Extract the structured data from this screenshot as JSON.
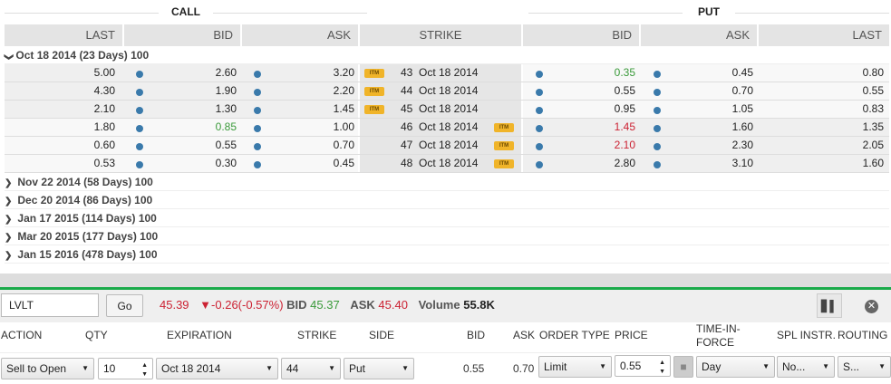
{
  "sections": {
    "call": "CALL",
    "put": "PUT"
  },
  "headers": [
    "LAST",
    "BID",
    "ASK",
    "STRIKE",
    "BID",
    "ASK",
    "LAST"
  ],
  "expanded_group": "Oct 18 2014 (23 Days) 100",
  "rows": [
    {
      "c_last": "5.00",
      "c_bid": "2.60",
      "c_ask": "3.20",
      "strike": "43",
      "exp": "Oct 18 2014",
      "itm": "call",
      "p_bid": "0.35",
      "p_ask": "0.45",
      "p_last": "0.80",
      "c_bid_color": "",
      "p_bid_color": "g"
    },
    {
      "c_last": "4.30",
      "c_bid": "1.90",
      "c_ask": "2.20",
      "strike": "44",
      "exp": "Oct 18 2014",
      "itm": "call",
      "p_bid": "0.55",
      "p_ask": "0.70",
      "p_last": "0.55",
      "c_bid_color": "",
      "p_bid_color": ""
    },
    {
      "c_last": "2.10",
      "c_bid": "1.30",
      "c_ask": "1.45",
      "strike": "45",
      "exp": "Oct 18 2014",
      "itm": "call",
      "p_bid": "0.95",
      "p_ask": "1.05",
      "p_last": "0.83",
      "c_bid_color": "",
      "p_bid_color": ""
    },
    {
      "c_last": "1.80",
      "c_bid": "0.85",
      "c_ask": "1.00",
      "strike": "46",
      "exp": "Oct 18 2014",
      "itm": "put",
      "p_bid": "1.45",
      "p_ask": "1.60",
      "p_last": "1.35",
      "c_bid_color": "g",
      "p_bid_color": "rd"
    },
    {
      "c_last": "0.60",
      "c_bid": "0.55",
      "c_ask": "0.70",
      "strike": "47",
      "exp": "Oct 18 2014",
      "itm": "put",
      "p_bid": "2.10",
      "p_ask": "2.30",
      "p_last": "2.05",
      "c_bid_color": "",
      "p_bid_color": "rd"
    },
    {
      "c_last": "0.53",
      "c_bid": "0.30",
      "c_ask": "0.45",
      "strike": "48",
      "exp": "Oct 18 2014",
      "itm": "put",
      "p_bid": "2.80",
      "p_ask": "3.10",
      "p_last": "1.60",
      "c_bid_color": "",
      "p_bid_color": ""
    }
  ],
  "itm_label": "ITM",
  "collapsed_groups": [
    "Nov 22 2014 (58 Days) 100",
    "Dec 20 2014 (86 Days) 100",
    "Jan 17 2015 (114 Days) 100",
    "Mar 20 2015 (177 Days) 100",
    "Jan 15 2016 (478 Days) 100"
  ],
  "ticket": {
    "symbol": "LVLT",
    "go": "Go",
    "price": "45.39",
    "change": "-0.26(-0.57%)",
    "bid_label": "BID",
    "bid": "45.37",
    "ask_label": "ASK",
    "ask": "45.40",
    "volume_label": "Volume",
    "volume": "55.8K",
    "labels": {
      "action": "ACTION",
      "qty": "QTY",
      "expiration": "EXPIRATION",
      "strike": "STRIKE",
      "side": "SIDE",
      "bid": "BID",
      "ask": "ASK",
      "order_type": "ORDER TYPE",
      "price": "PRICE",
      "tif": "TIME-IN-FORCE",
      "spl": "SPL INSTR.",
      "routing": "ROUTING"
    },
    "values": {
      "action": "Sell to Open",
      "qty": "10",
      "expiration": "Oct 18 2014",
      "strike": "44",
      "side": "Put",
      "bid": "0.55",
      "ask": "0.70",
      "order_type": "Limit",
      "price": "0.55",
      "tif": "Day",
      "spl": "No...",
      "routing": "S..."
    }
  },
  "colors": {
    "accent_green": "#1aaa4a",
    "up": "#3a9a3a",
    "down": "#cc2233",
    "dot": "#3a7aab",
    "itm": "#f0b429"
  }
}
